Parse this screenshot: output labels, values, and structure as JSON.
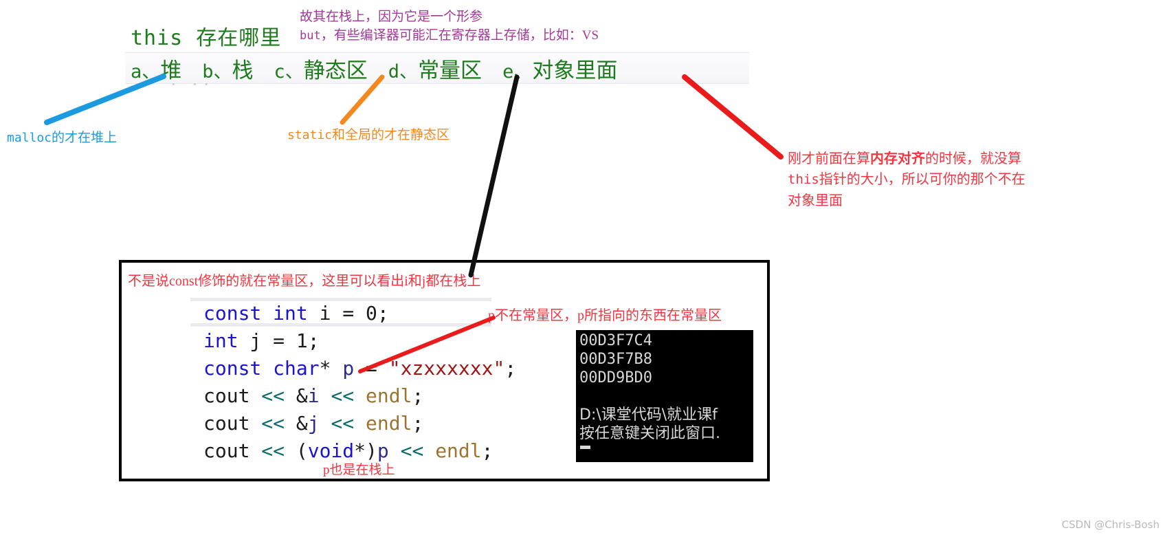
{
  "slide": {
    "question_title": "this 存在哪里",
    "purple_note_line1": "故其在栈上，因为它是一个形参",
    "purple_note_line2_mono": "but",
    "purple_note_line2_rest": "，有些编译器可能汇在寄存器上存储，比如：VS",
    "options": [
      {
        "key": "a、",
        "label": "堆"
      },
      {
        "key": "b、",
        "label": "栈"
      },
      {
        "key": "c、",
        "label": "静态区"
      },
      {
        "key": "d、",
        "label": "常量区"
      },
      {
        "key": "e、",
        "label": "对象里面"
      }
    ],
    "ghost_row": "· ··"
  },
  "annotations": {
    "blue_malloc_mono": "malloc",
    "blue_malloc_rest": "的才在堆上",
    "orange_static_mono": "static",
    "orange_static_rest": "和全局的才在静态区",
    "red_right_line1_a": "刚才前面在算",
    "red_right_line1_b": "内存对齐",
    "red_right_line1_c": "的时候，就没算",
    "red_right_line2_mono": "this",
    "red_right_line2_rest": "指针的大小，所以可你的那个不在",
    "red_right_line3": "对象里面",
    "box_note": "不是说const修饰的就在常量区，这里可以看出i和j都在栈上",
    "p_not_const": "p不在常量区，p所指向的东西在常量区",
    "p_on_stack": "p也是在栈上"
  },
  "code": {
    "lines": [
      [
        {
          "t": "const",
          "c": "kw"
        },
        {
          "t": " ",
          "c": "idf"
        },
        {
          "t": "int",
          "c": "kw"
        },
        {
          "t": " i = ",
          "c": "idf"
        },
        {
          "t": "0",
          "c": "num"
        },
        {
          "t": ";",
          "c": "idf"
        }
      ],
      [
        {
          "t": "int",
          "c": "kw"
        },
        {
          "t": " j = ",
          "c": "idf"
        },
        {
          "t": "1",
          "c": "num"
        },
        {
          "t": ";",
          "c": "idf"
        }
      ],
      [
        {
          "t": "const",
          "c": "kw"
        },
        {
          "t": " ",
          "c": "idf"
        },
        {
          "t": "char",
          "c": "kw"
        },
        {
          "t": "* ",
          "c": "idf"
        },
        {
          "t": "p",
          "c": "ident-blue"
        },
        {
          "t": " = ",
          "c": "idf"
        },
        {
          "t": "\"xzxxxxxx\"",
          "c": "str"
        },
        {
          "t": ";",
          "c": "idf"
        }
      ],
      [
        {
          "t": "cout ",
          "c": "idf"
        },
        {
          "t": "<<",
          "c": "op"
        },
        {
          "t": " &",
          "c": "idf"
        },
        {
          "t": "i",
          "c": "ident-blue"
        },
        {
          "t": " ",
          "c": "idf"
        },
        {
          "t": "<<",
          "c": "op"
        },
        {
          "t": " ",
          "c": "idf"
        },
        {
          "t": "endl",
          "c": "endl"
        },
        {
          "t": ";",
          "c": "idf"
        }
      ],
      [
        {
          "t": "cout ",
          "c": "idf"
        },
        {
          "t": "<<",
          "c": "op"
        },
        {
          "t": " &",
          "c": "idf"
        },
        {
          "t": "j",
          "c": "ident-blue"
        },
        {
          "t": " ",
          "c": "idf"
        },
        {
          "t": "<<",
          "c": "op"
        },
        {
          "t": " ",
          "c": "idf"
        },
        {
          "t": "endl",
          "c": "endl"
        },
        {
          "t": ";",
          "c": "idf"
        }
      ],
      [
        {
          "t": "cout ",
          "c": "idf"
        },
        {
          "t": "<<",
          "c": "op"
        },
        {
          "t": " (",
          "c": "idf"
        },
        {
          "t": "void",
          "c": "kw"
        },
        {
          "t": "*)",
          "c": "idf"
        },
        {
          "t": "p",
          "c": "ident-blue"
        },
        {
          "t": " ",
          "c": "idf"
        },
        {
          "t": "<<",
          "c": "op"
        },
        {
          "t": " ",
          "c": "idf"
        },
        {
          "t": "endl",
          "c": "endl"
        },
        {
          "t": ";",
          "c": "idf"
        }
      ]
    ]
  },
  "console": {
    "addresses": [
      "00D3F7C4",
      "00D3F7B8",
      "00DD9BD0"
    ],
    "path_line": "D:\\课堂代码\\就业课f",
    "prompt_line": "按任意键关闭此窗口."
  },
  "watermark": "CSDN @Chris-Bosh",
  "colors": {
    "green": "#1d7a1d",
    "purple": "#a4379a",
    "blue": "#1b9ae0",
    "orange": "#f2881e",
    "red": "#f4353f",
    "code_keyword": "#1a13d2",
    "code_string": "#a11515",
    "code_operator": "#0b6a6a",
    "code_endl": "#9a7430",
    "console_bg": "#000000",
    "console_fg": "#d8d8d8"
  }
}
